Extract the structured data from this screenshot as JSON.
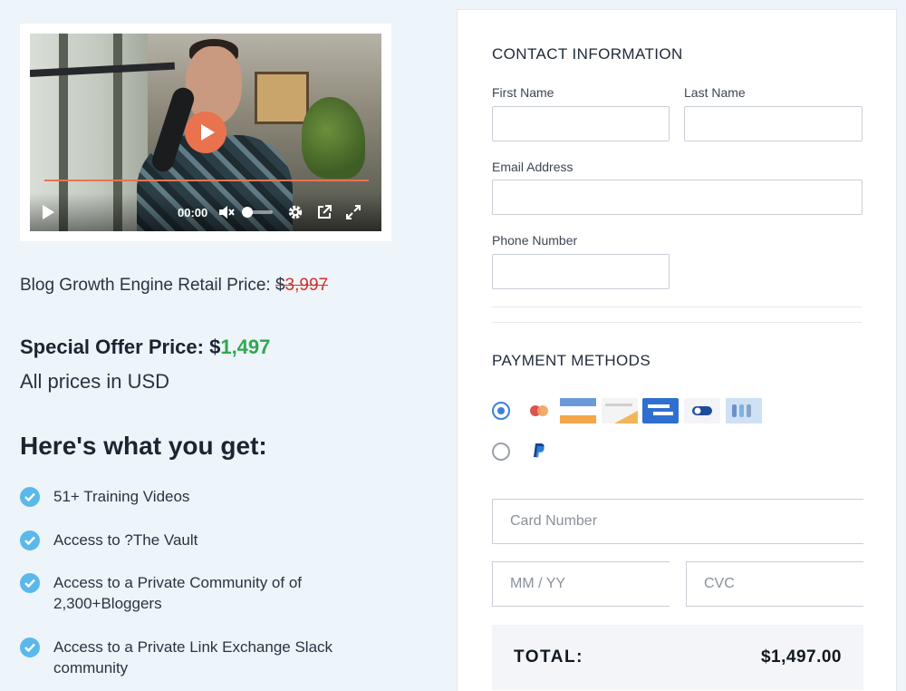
{
  "video": {
    "time": "00:00",
    "progress": 0
  },
  "pricing": {
    "retail_label": "Blog Growth Engine Retail Price: ",
    "retail_currency": "$",
    "retail_price": "3,997",
    "special_label": "Special Offer Price: $",
    "special_price": "1,497",
    "currency_note": "All prices in USD"
  },
  "benefits": {
    "heading": "Here's what you get:",
    "items": [
      "51+ Training Videos",
      "Access to ?The Vault",
      "Access to a Private Community of of 2,300+Bloggers",
      "Access to a Private Link Exchange Slack community"
    ]
  },
  "contact": {
    "title": "CONTACT INFORMATION",
    "first_name_label": "First Name",
    "last_name_label": "Last Name",
    "email_label": "Email Address",
    "phone_label": "Phone Number",
    "first_name_value": "",
    "last_name_value": "",
    "email_value": "",
    "phone_value": ""
  },
  "payment": {
    "title": "PAYMENT METHODS",
    "selected_method": "card",
    "card_icons": [
      "mastercard-icon",
      "card-brand-orange-icon",
      "card-brand-light-icon",
      "card-brand-blue-icon",
      "card-brand-toggle-icon",
      "card-brand-stripes-icon"
    ],
    "paypal_icon": "paypal-icon",
    "card_number_placeholder": "Card Number",
    "expiry_placeholder": "MM / YY",
    "cvc_placeholder": "CVC"
  },
  "total": {
    "label": "TOTAL:",
    "value": "$1,497.00"
  },
  "colors": {
    "accent_orange": "#e8734e",
    "check_blue": "#5bb8ea",
    "strike_red": "#d1312b",
    "price_green": "#2fa84f",
    "radio_blue": "#3f7fdc"
  }
}
